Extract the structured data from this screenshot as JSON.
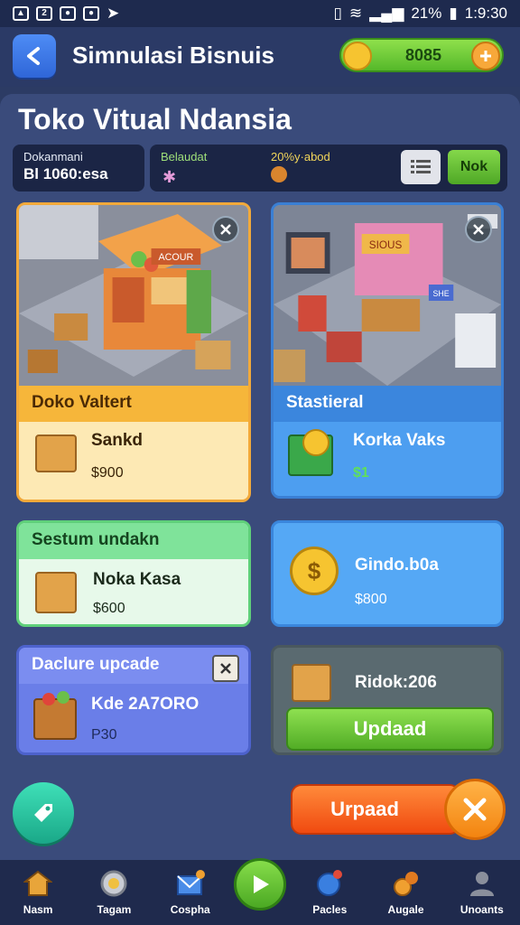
{
  "status_bar": {
    "battery": "21%",
    "time": "1:9:30"
  },
  "header": {
    "title": "Simnulasi Bisnuis",
    "coins": "8085"
  },
  "page": {
    "title": "Toko Vitual Ndansia"
  },
  "info": {
    "box1_label": "Dokanmani",
    "box1_value": "Bl 1060:esa",
    "box2_label_left": "Belaudat",
    "box2_label_right": "20%y·abod",
    "ok_label": "Nok"
  },
  "cards": {
    "c1": {
      "header": "Doko Valtert",
      "name": "Sankd",
      "price": "$900",
      "sign": "ACOUR"
    },
    "c2": {
      "header": "Stastieral",
      "name": "Korka Vaks",
      "price": "$1",
      "sign": "SIOUS",
      "sign2": "SHE"
    },
    "c3": {
      "header": "Sestum undakn",
      "name": "Noka Kasa",
      "price": "$600"
    },
    "c4": {
      "name": "Gindo.b0a",
      "price": "$800"
    },
    "c5": {
      "header": "Daclure upcade",
      "name": "Kde 2A7ORO",
      "price": "P30"
    },
    "c6": {
      "name": "Ridok:206",
      "button": "Updaad"
    }
  },
  "bottom": {
    "update_label": "Urpaad"
  },
  "nav": {
    "items": [
      "Nasm",
      "Tagam",
      "Cospha",
      "Pacles",
      "Augale",
      "Unoants"
    ]
  },
  "colors": {
    "accent_green": "#55b82a",
    "accent_orange": "#f04a10",
    "panel": "#3a4b7b"
  }
}
